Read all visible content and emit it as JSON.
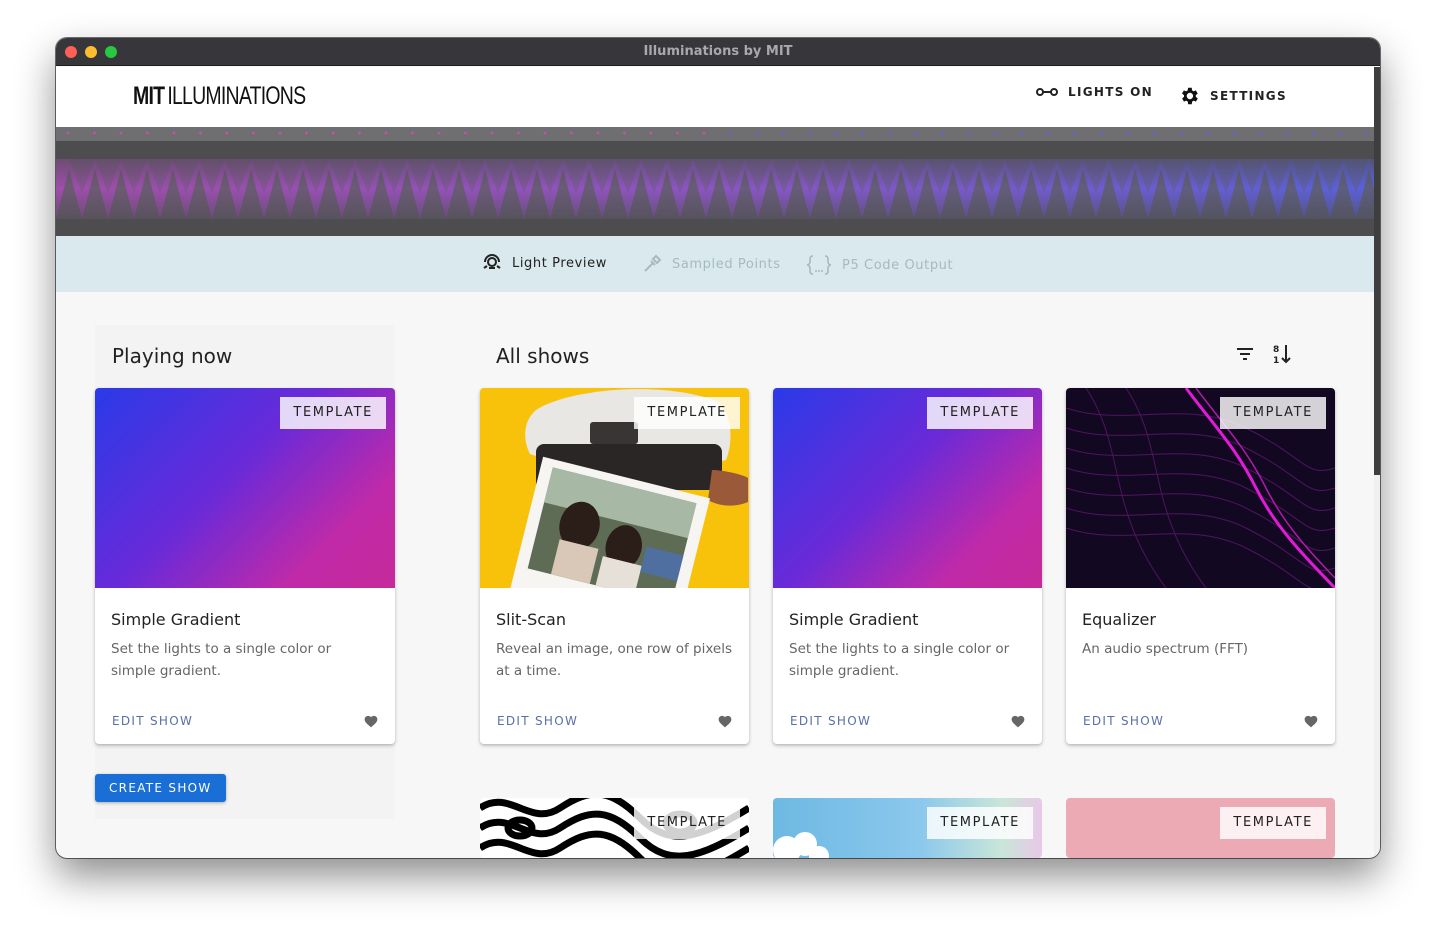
{
  "window": {
    "title": "Illuminations by MIT"
  },
  "header": {
    "logo_bold": "MIT",
    "logo_text": "ILLUMINATIONS",
    "lights_label": "LIGHTS ON",
    "settings_label": "SETTINGS"
  },
  "tabs": [
    {
      "label": "Light Preview",
      "icon": "light-preview-icon",
      "active": true
    },
    {
      "label": "Sampled Points",
      "icon": "eyedropper-icon",
      "active": false
    },
    {
      "label": "P5 Code Output",
      "icon": "code-braces-icon",
      "active": false
    }
  ],
  "playing_now": {
    "title": "Playing now",
    "card": {
      "badge": "TEMPLATE",
      "title": "Simple Gradient",
      "description": "Set the lights to a single color or simple gradient.",
      "action": "EDIT SHOW"
    },
    "create_label": "CREATE SHOW"
  },
  "all_shows": {
    "title": "All shows",
    "cards": [
      {
        "badge": "TEMPLATE",
        "title": "Slit-Scan",
        "description": "Reveal an image, one row of pixels at a time.",
        "action": "EDIT SHOW",
        "image": "instant-camera-photo"
      },
      {
        "badge": "TEMPLATE",
        "title": "Simple Gradient",
        "description": "Set the lights to a single color or simple gradient.",
        "action": "EDIT SHOW",
        "image": "blue-magenta-gradient"
      },
      {
        "badge": "TEMPLATE",
        "title": "Equalizer",
        "description": "An audio spectrum (FFT)",
        "action": "EDIT SHOW",
        "image": "magenta-wave-lines"
      }
    ],
    "next_row": [
      {
        "badge": "TEMPLATE",
        "image": "zebra-pattern"
      },
      {
        "badge": "TEMPLATE",
        "image": "sky-clouds"
      },
      {
        "badge": "TEMPLATE",
        "image": "pink-fill"
      }
    ]
  },
  "colors": {
    "accent": "#1a6fd6",
    "link": "#5a6fa8",
    "tab_bar": "#d9e9ee",
    "preview_bg": "#4d4d50"
  }
}
